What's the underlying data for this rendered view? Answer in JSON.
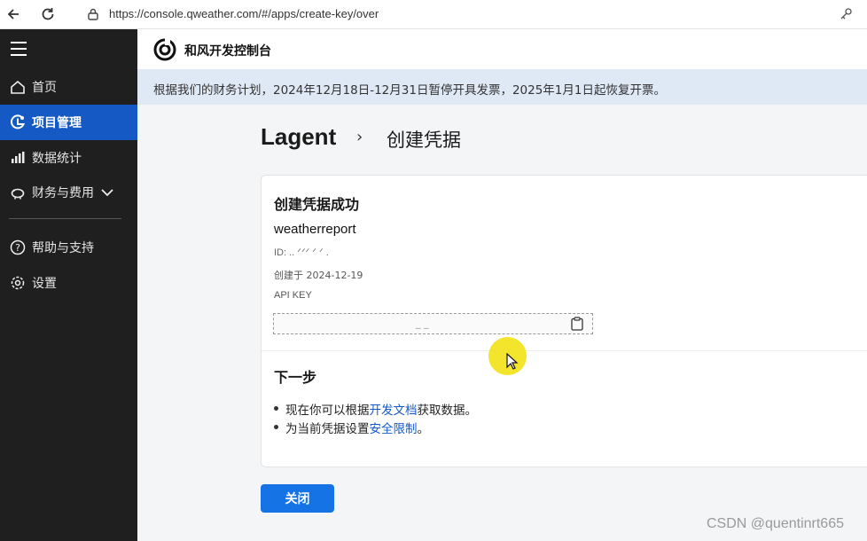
{
  "browser": {
    "url": "https://console.qweather.com/#/apps/create-key/over",
    "back_icon": "arrow-left-icon",
    "reload_icon": "reload-icon",
    "lock_icon": "lock-icon",
    "key_icon": "key-icon"
  },
  "sidebar": {
    "menu_icon": "hamburger-icon",
    "items": [
      {
        "label": "首页",
        "icon": "home-icon"
      },
      {
        "label": "项目管理",
        "icon": "project-icon",
        "active": true
      },
      {
        "label": "数据统计",
        "icon": "stats-icon"
      },
      {
        "label": "财务与费用",
        "icon": "piggy-bank-icon"
      },
      {
        "label": "帮助与支持",
        "icon": "help-icon"
      },
      {
        "label": "设置",
        "icon": "gear-icon"
      }
    ]
  },
  "header": {
    "app_title": "和风开发控制台",
    "logo_icon": "qweather-logo-icon"
  },
  "notice": {
    "text": "根据我们的财务计划，2024年12月18日-12月31日暂停开具发票，2025年1月1日起恢复开票。"
  },
  "breadcrumb": {
    "project": "Lagent",
    "separator": "›",
    "page": "创建凭据"
  },
  "card": {
    "title": "创建凭据成功",
    "credential_name": "weatherreport",
    "id_text": "ID: .. ᐟᐟᐟ ᐟ ᐟ  .",
    "created_text": "创建于 2024-12-19",
    "apikey_label": "API KEY",
    "apikey_value": "_ _",
    "next_title": "下一步",
    "steps": [
      {
        "prefix": "现在你可以根据",
        "link": "开发文档",
        "suffix": "获取数据。"
      },
      {
        "prefix": "为当前凭据设置",
        "link": "安全限制",
        "suffix": "。"
      }
    ]
  },
  "close_button": "关闭",
  "watermark": "CSDN @quentinrt665",
  "colors": {
    "sidebar_bg": "#1f1f1f",
    "active_item": "#1559c4",
    "primary_button": "#1673e6",
    "notice_bg": "#dfe9f5",
    "link": "#1559c4"
  }
}
